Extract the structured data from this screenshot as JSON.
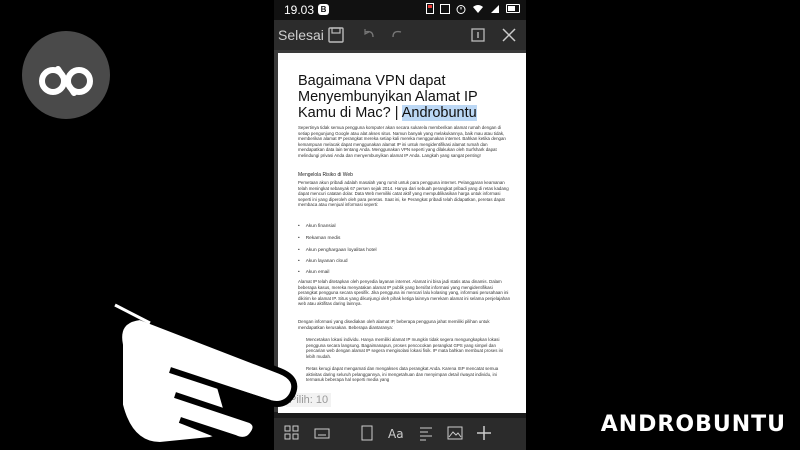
{
  "status": {
    "time": "19.03",
    "badge": "B"
  },
  "toolbar": {
    "done_label": "Selesai"
  },
  "document": {
    "title_main": "Bagaimana VPN dapat Menyembunyikan Alamat IP Kamu di Mac? | ",
    "title_highlight": "Androbuntu",
    "paragraph1": "Sepertinya tidak semua pengguna komputer akan secara sukarela memberikan alamat rumah dengan di setiap pengunjung Google atau alat akses situs. Namun banyak yang melakukannya, baik mau atau tidak, memberikan alamat IP perangkat mereka setiap kali mereka menggunakan internet. Bahkan ketika dengan kemampuan melacak dapat menggunakan alamat IP ini untuk mengidentifikasi alamat rumah dan mendapatkan data lain tentang Anda. Menggunakan VPN seperti yang dilakukan oleh Surfshark dapat melindungi privasi Anda dan menyembunyikan alamat IP Anda. Langkah yang sangat penting!",
    "section_heading": "Mengelola Risiko di Web",
    "paragraph2": "Pemetaan akun pribadi adalah masalah yang rumit untuk para pengguna internet. Pelanggaran keamanan telah meningkat sebanyak 67 persen sejak 2014. Hanya dari sebuah perangkat pribadi yang di retas kadang dapat mencuri catatan dolar. Data Web memiliki catat aktif yang mempublikasikan harga untuk informasi seperti ini yang diperoleh oleh para peretas. Saat ini, ke Perangkat pribadi telah didapatkan, peretas dapat membaca atau menjual informasi seperti:",
    "bullets": [
      "Akun finansial",
      "Rekaman medis",
      "Akun penghargaan loyalitas hotel",
      "Akun layanan cloud",
      "Akun email"
    ],
    "paragraph3": "Alamat IP telah ditetapkan oleh penyedia layanan internet. Alamat ini bisa jadi statis atau dinamis. Dalam beberapa kasus, mereka menyatakan alamat IP publik yang bersifat informasi yang mengidentifikasi perangkat pengguna secara spesifik. Jika pengguna ini mencari lalu kolasing yang, informasi perusahaan ini dikirim ke alamat IP. Situs yang dikunjungi oleh pihak ketiga lainnya merekam alamat ini selama penjelajahan web atau aktifitas daring lainnya.",
    "paragraph4": "Dengan informasi yang disediakan oleh alamat IP, beberapa pengguna jahat memiliki pilihan untuk mendapatkan kerusakan. Beberapa diantaranya:",
    "bullet_long1": "Mencetakan lokasi individu. Hanya memiliki alamat IP mungkin tidak segera mengungkapkan lokasi pengguna secara langsung. Bagaimanapun, proses pencocokan perangkat GPS yang simpel dan pencarian web dengan alamat IP segera mengisolasi lokasi fisik. IP mata bahkan membuat proses ini lebih mudah.",
    "bullet_long2": "Retas kerugi dapat mengamati dan mengakses data perangkat Anda. Karena ISP mencatat semua aktivitas daring seluruh pelanggannya, ini mengetahuan dan menyimpan detail riwayat individu, ini termasuk beberapa hal seperti media yang"
  },
  "selection": {
    "label": "Pilih: 10"
  },
  "brand": {
    "watermark": "ANDROBUNTU"
  }
}
